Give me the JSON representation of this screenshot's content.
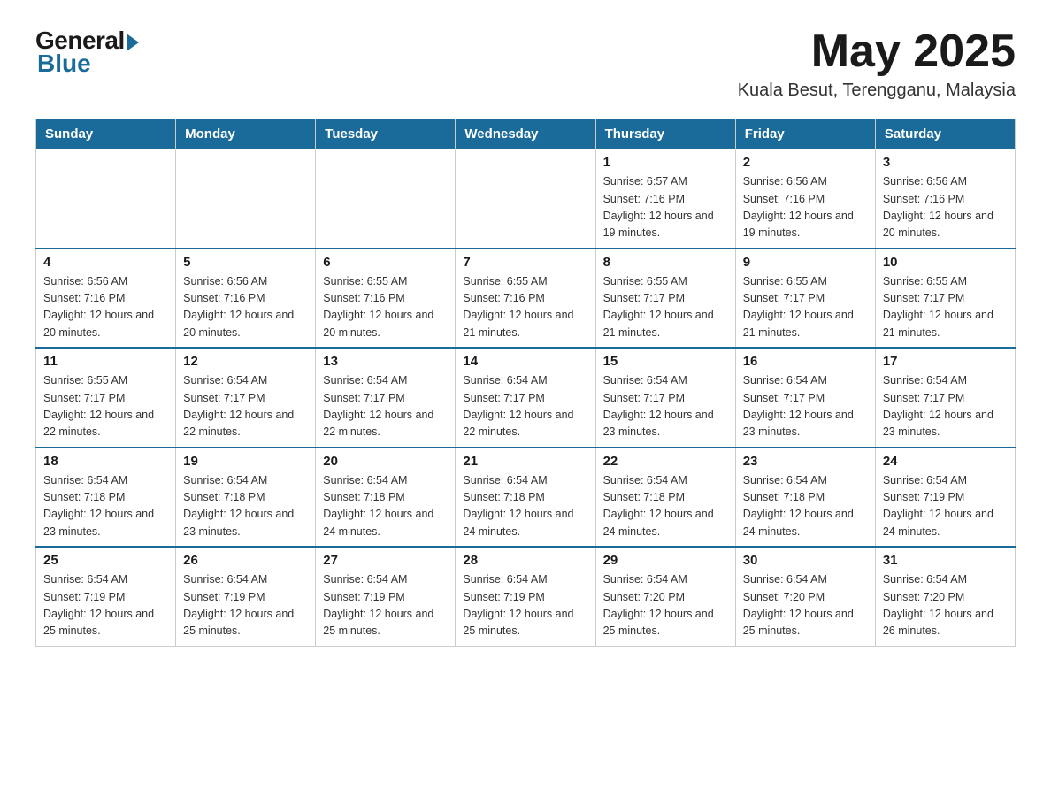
{
  "logo": {
    "general": "General",
    "blue": "Blue"
  },
  "header": {
    "month": "May 2025",
    "location": "Kuala Besut, Terengganu, Malaysia"
  },
  "weekdays": [
    "Sunday",
    "Monday",
    "Tuesday",
    "Wednesday",
    "Thursday",
    "Friday",
    "Saturday"
  ],
  "weeks": [
    [
      {
        "day": "",
        "sunrise": "",
        "sunset": "",
        "daylight": ""
      },
      {
        "day": "",
        "sunrise": "",
        "sunset": "",
        "daylight": ""
      },
      {
        "day": "",
        "sunrise": "",
        "sunset": "",
        "daylight": ""
      },
      {
        "day": "",
        "sunrise": "",
        "sunset": "",
        "daylight": ""
      },
      {
        "day": "1",
        "sunrise": "Sunrise: 6:57 AM",
        "sunset": "Sunset: 7:16 PM",
        "daylight": "Daylight: 12 hours and 19 minutes."
      },
      {
        "day": "2",
        "sunrise": "Sunrise: 6:56 AM",
        "sunset": "Sunset: 7:16 PM",
        "daylight": "Daylight: 12 hours and 19 minutes."
      },
      {
        "day": "3",
        "sunrise": "Sunrise: 6:56 AM",
        "sunset": "Sunset: 7:16 PM",
        "daylight": "Daylight: 12 hours and 20 minutes."
      }
    ],
    [
      {
        "day": "4",
        "sunrise": "Sunrise: 6:56 AM",
        "sunset": "Sunset: 7:16 PM",
        "daylight": "Daylight: 12 hours and 20 minutes."
      },
      {
        "day": "5",
        "sunrise": "Sunrise: 6:56 AM",
        "sunset": "Sunset: 7:16 PM",
        "daylight": "Daylight: 12 hours and 20 minutes."
      },
      {
        "day": "6",
        "sunrise": "Sunrise: 6:55 AM",
        "sunset": "Sunset: 7:16 PM",
        "daylight": "Daylight: 12 hours and 20 minutes."
      },
      {
        "day": "7",
        "sunrise": "Sunrise: 6:55 AM",
        "sunset": "Sunset: 7:16 PM",
        "daylight": "Daylight: 12 hours and 21 minutes."
      },
      {
        "day": "8",
        "sunrise": "Sunrise: 6:55 AM",
        "sunset": "Sunset: 7:17 PM",
        "daylight": "Daylight: 12 hours and 21 minutes."
      },
      {
        "day": "9",
        "sunrise": "Sunrise: 6:55 AM",
        "sunset": "Sunset: 7:17 PM",
        "daylight": "Daylight: 12 hours and 21 minutes."
      },
      {
        "day": "10",
        "sunrise": "Sunrise: 6:55 AM",
        "sunset": "Sunset: 7:17 PM",
        "daylight": "Daylight: 12 hours and 21 minutes."
      }
    ],
    [
      {
        "day": "11",
        "sunrise": "Sunrise: 6:55 AM",
        "sunset": "Sunset: 7:17 PM",
        "daylight": "Daylight: 12 hours and 22 minutes."
      },
      {
        "day": "12",
        "sunrise": "Sunrise: 6:54 AM",
        "sunset": "Sunset: 7:17 PM",
        "daylight": "Daylight: 12 hours and 22 minutes."
      },
      {
        "day": "13",
        "sunrise": "Sunrise: 6:54 AM",
        "sunset": "Sunset: 7:17 PM",
        "daylight": "Daylight: 12 hours and 22 minutes."
      },
      {
        "day": "14",
        "sunrise": "Sunrise: 6:54 AM",
        "sunset": "Sunset: 7:17 PM",
        "daylight": "Daylight: 12 hours and 22 minutes."
      },
      {
        "day": "15",
        "sunrise": "Sunrise: 6:54 AM",
        "sunset": "Sunset: 7:17 PM",
        "daylight": "Daylight: 12 hours and 23 minutes."
      },
      {
        "day": "16",
        "sunrise": "Sunrise: 6:54 AM",
        "sunset": "Sunset: 7:17 PM",
        "daylight": "Daylight: 12 hours and 23 minutes."
      },
      {
        "day": "17",
        "sunrise": "Sunrise: 6:54 AM",
        "sunset": "Sunset: 7:17 PM",
        "daylight": "Daylight: 12 hours and 23 minutes."
      }
    ],
    [
      {
        "day": "18",
        "sunrise": "Sunrise: 6:54 AM",
        "sunset": "Sunset: 7:18 PM",
        "daylight": "Daylight: 12 hours and 23 minutes."
      },
      {
        "day": "19",
        "sunrise": "Sunrise: 6:54 AM",
        "sunset": "Sunset: 7:18 PM",
        "daylight": "Daylight: 12 hours and 23 minutes."
      },
      {
        "day": "20",
        "sunrise": "Sunrise: 6:54 AM",
        "sunset": "Sunset: 7:18 PM",
        "daylight": "Daylight: 12 hours and 24 minutes."
      },
      {
        "day": "21",
        "sunrise": "Sunrise: 6:54 AM",
        "sunset": "Sunset: 7:18 PM",
        "daylight": "Daylight: 12 hours and 24 minutes."
      },
      {
        "day": "22",
        "sunrise": "Sunrise: 6:54 AM",
        "sunset": "Sunset: 7:18 PM",
        "daylight": "Daylight: 12 hours and 24 minutes."
      },
      {
        "day": "23",
        "sunrise": "Sunrise: 6:54 AM",
        "sunset": "Sunset: 7:18 PM",
        "daylight": "Daylight: 12 hours and 24 minutes."
      },
      {
        "day": "24",
        "sunrise": "Sunrise: 6:54 AM",
        "sunset": "Sunset: 7:19 PM",
        "daylight": "Daylight: 12 hours and 24 minutes."
      }
    ],
    [
      {
        "day": "25",
        "sunrise": "Sunrise: 6:54 AM",
        "sunset": "Sunset: 7:19 PM",
        "daylight": "Daylight: 12 hours and 25 minutes."
      },
      {
        "day": "26",
        "sunrise": "Sunrise: 6:54 AM",
        "sunset": "Sunset: 7:19 PM",
        "daylight": "Daylight: 12 hours and 25 minutes."
      },
      {
        "day": "27",
        "sunrise": "Sunrise: 6:54 AM",
        "sunset": "Sunset: 7:19 PM",
        "daylight": "Daylight: 12 hours and 25 minutes."
      },
      {
        "day": "28",
        "sunrise": "Sunrise: 6:54 AM",
        "sunset": "Sunset: 7:19 PM",
        "daylight": "Daylight: 12 hours and 25 minutes."
      },
      {
        "day": "29",
        "sunrise": "Sunrise: 6:54 AM",
        "sunset": "Sunset: 7:20 PM",
        "daylight": "Daylight: 12 hours and 25 minutes."
      },
      {
        "day": "30",
        "sunrise": "Sunrise: 6:54 AM",
        "sunset": "Sunset: 7:20 PM",
        "daylight": "Daylight: 12 hours and 25 minutes."
      },
      {
        "day": "31",
        "sunrise": "Sunrise: 6:54 AM",
        "sunset": "Sunset: 7:20 PM",
        "daylight": "Daylight: 12 hours and 26 minutes."
      }
    ]
  ]
}
